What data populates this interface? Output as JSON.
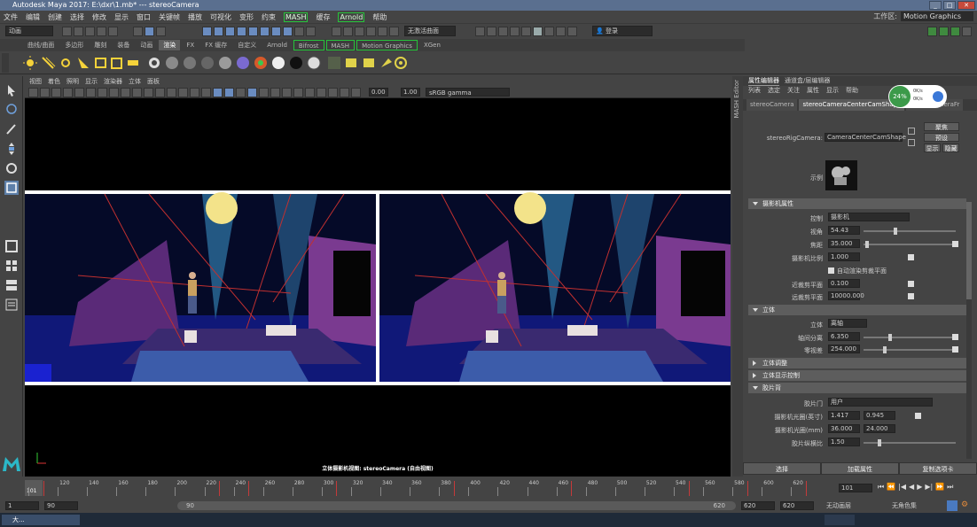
{
  "titlebar": {
    "title": "Autodesk Maya 2017: E:\\dxr\\1.mb*   ---   stereoCamera",
    "min": "_",
    "max": "□",
    "close": "✕"
  },
  "menubar": {
    "items": [
      "文件",
      "编辑",
      "创建",
      "选择",
      "修改",
      "显示",
      "窗口",
      "关键帧",
      "播放",
      "可视化",
      "变形",
      "约束",
      "MASH",
      "缓存",
      "Arnold",
      "帮助"
    ],
    "workspace_label": "工作区:",
    "workspace_value": "Motion Graphics"
  },
  "statusline": {
    "mode": "动画",
    "live_surface": "无激活曲面",
    "login": "登录"
  },
  "shelf_tabs": [
    "曲线/曲面",
    "多边形",
    "雕刻",
    "装备",
    "动画",
    "渲染",
    "FX",
    "FX 缓存",
    "自定义",
    "Arnold",
    "Bifrost",
    "MASH",
    "Motion Graphics",
    "XGen"
  ],
  "shelf_active": "渲染",
  "viewport_menu": [
    "视图",
    "着色",
    "照明",
    "显示",
    "渲染器",
    "立体",
    "面板"
  ],
  "viewport_toolbar": {
    "exposure": "0.00",
    "gamma": "1.00",
    "colorspace": "sRGB gamma"
  },
  "viewport_label": "立体摄影机视图: stereoCamera (自由视图)",
  "attr_editor": {
    "top_tabs": [
      "属性编辑器",
      "通道盒/层编辑器"
    ],
    "menu": [
      "列表",
      "选定",
      "关注",
      "属性",
      "显示",
      "帮助"
    ],
    "node_tabs": [
      "stereoCamera",
      "stereoCameraCenterCamShape",
      "stereoCameraFr"
    ],
    "rig_label": "stereoRigCamera:",
    "rig_value": "CameraCenterCamShape",
    "focus_btn": "聚焦",
    "preset_btn": "预设",
    "show_btn": "显示",
    "hide_btn": "隐藏",
    "sample_label": "示例",
    "sections": {
      "camera_attrs": "摄影机属性",
      "stereo": "立体",
      "stereo_adjust": "立体调整",
      "stereo_display": "立体显示控制",
      "film_back": "胶片背"
    },
    "controls": {
      "control_label": "控制",
      "control_value": "摄影机"
    },
    "fields": [
      {
        "label": "视角",
        "value": "54.43"
      },
      {
        "label": "焦距",
        "value": "35.000"
      },
      {
        "label": "摄影机比例",
        "value": "1.000"
      },
      {
        "label": "近裁剪平面",
        "value": "0.100"
      },
      {
        "label": "远裁剪平面",
        "value": "10000.000"
      }
    ],
    "auto_clip": "自动渲染剪裁平面",
    "stereo_fields": {
      "stereo_label": "立体",
      "stereo_value": "离轴",
      "interaxial_label": "轴间分离",
      "interaxial_value": "6.350",
      "zero_label": "零视差",
      "zero_value": "254.000"
    },
    "film": {
      "gate_label": "胶片门",
      "gate_value": "用户",
      "aperture_in_label": "摄影机光圈(英寸)",
      "aperture_in_w": "1.417",
      "aperture_in_h": "0.945",
      "aperture_mm_label": "摄影机光圈(mm)",
      "aperture_mm_w": "36.000",
      "aperture_mm_h": "24.000",
      "ratio_label": "胶片纵横比",
      "ratio_value": "1.50"
    },
    "footer": [
      "选择",
      "加载属性",
      "复制选项卡"
    ]
  },
  "perf_widget": {
    "percent": "24%",
    "up": "0K/s",
    "down": "0K/s"
  },
  "timeline": {
    "current_frame": "101",
    "current_frame_field": "101",
    "ticks": [
      "100",
      "120",
      "140",
      "160",
      "180",
      "200",
      "220",
      "240",
      "260",
      "280",
      "300",
      "320",
      "340",
      "360",
      "380",
      "400",
      "420",
      "440",
      "460",
      "480",
      "500",
      "520",
      "540",
      "560",
      "580",
      "600",
      "620"
    ]
  },
  "range": {
    "start": "1",
    "playback_start": "90",
    "range_start_label": "90",
    "range_end_label": "620",
    "playback_end": "620",
    "end": "620",
    "anim_layer": "无动画层",
    "char_set": "无角色集"
  },
  "taskbar": {
    "item": "大..."
  }
}
